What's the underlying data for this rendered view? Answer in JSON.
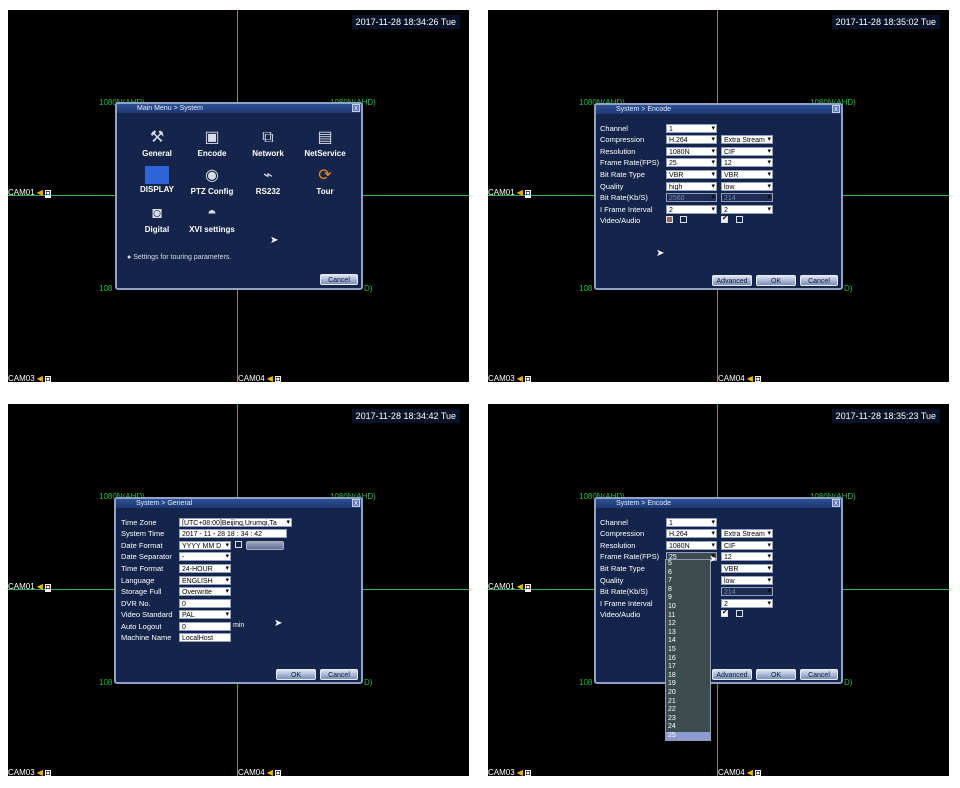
{
  "timestamps": {
    "q1": "2017-11-28 18:34:26 Tue",
    "q2": "2017-11-28 18:35:02 Tue",
    "q3": "2017-11-28 18:34:42 Tue",
    "q4": "2017-11-28 18:35:23 Tue"
  },
  "cams": {
    "cam01": "CAM01",
    "cam03": "CAM03",
    "cam04": "CAM04"
  },
  "res": {
    "left": "1080N(AHD)",
    "right": "1080N(AHD)",
    "left_short": "108",
    "right_tail": "D)"
  },
  "main_menu": {
    "title": "Main Menu > System",
    "items": [
      {
        "label": "General",
        "icon": "tools-icon"
      },
      {
        "label": "Encode",
        "icon": "encode-icon"
      },
      {
        "label": "Network",
        "icon": "network-icon"
      },
      {
        "label": "NetService",
        "icon": "netservice-icon"
      },
      {
        "label": "DISPLAY",
        "icon": "display-icon"
      },
      {
        "label": "PTZ Config",
        "icon": "ptz-icon"
      },
      {
        "label": "RS232",
        "icon": "rs232-icon"
      },
      {
        "label": "Tour",
        "icon": "tour-icon"
      },
      {
        "label": "Digital",
        "icon": "camera-icon"
      },
      {
        "label": "XVI settings",
        "icon": "dome-camera-icon"
      }
    ],
    "hint": "Settings for touring parameters.",
    "cancel": "Cancel"
  },
  "encode": {
    "title": "System > Encode",
    "labels": [
      "Channel",
      "Compression",
      "Resolution",
      "Frame Rate(FPS)",
      "Bit Rate Type",
      "Quality",
      "Bit Rate(Kb/S)",
      "I Frame Interval",
      "Video/Audio"
    ],
    "main": [
      "1",
      "H.264",
      "1080N",
      "25",
      "VBR",
      "high",
      "2560",
      "2"
    ],
    "extra": [
      "Extra Stream",
      "CIF",
      "12",
      "VBR",
      "low",
      "214",
      "2"
    ],
    "buttons": {
      "advanced": "Advanced",
      "ok": "OK",
      "cancel": "Cancel"
    },
    "fps_options": [
      "5",
      "6",
      "7",
      "8",
      "9",
      "10",
      "11",
      "12",
      "13",
      "14",
      "15",
      "16",
      "17",
      "18",
      "19",
      "20",
      "21",
      "22",
      "23",
      "24",
      "25"
    ]
  },
  "general": {
    "title": "System > General",
    "labels": [
      "Time Zone",
      "System Time",
      "Date Format",
      "Date Separator",
      "Time Format",
      "Language",
      "Storage Full",
      "DVR No.",
      "Video Standard",
      "Auto Logout",
      "Machine Name"
    ],
    "values": [
      "[UTC+08:00]Beijing,Urumqi,Ta",
      "2017 - 11 - 28  18 : 34 : 42",
      "YYYY MM D",
      "-",
      "24-HOUR",
      "ENGLISH",
      "Overwrite",
      "0",
      "PAL",
      "0",
      "LocalHost"
    ],
    "unit_min": "min",
    "buttons": {
      "ok": "OK",
      "cancel": "Cancel"
    }
  },
  "colors": {
    "grid": "#29b84a",
    "dialog_bg": "#14244a",
    "dialog_border": "#90a3c4",
    "list_sel": "#8e9bd0"
  }
}
